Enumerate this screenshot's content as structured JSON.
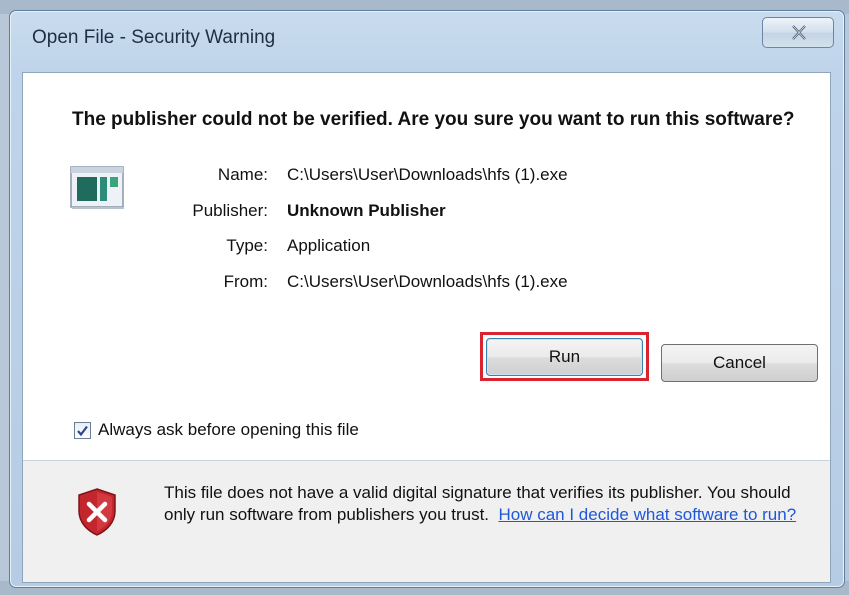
{
  "window": {
    "title": "Open File - Security Warning"
  },
  "message": {
    "headline": "The publisher could not be verified.  Are you sure you want to run this software?"
  },
  "details": [
    {
      "label": "Name:",
      "value": "C:\\Users\\User\\Downloads\\hfs (1).exe",
      "bold": false
    },
    {
      "label": "Publisher:",
      "value": "Unknown Publisher",
      "bold": true
    },
    {
      "label": "Type:",
      "value": "Application",
      "bold": false
    },
    {
      "label": "From:",
      "value": "C:\\Users\\User\\Downloads\\hfs (1).exe",
      "bold": false
    }
  ],
  "buttons": {
    "run": "Run",
    "cancel": "Cancel"
  },
  "checkbox": {
    "label": "Always ask before opening this file",
    "checked": true
  },
  "footer": {
    "text": "This file does not have a valid digital signature that verifies its publisher. You should only run software from publishers you trust.",
    "link": "How can I decide what software to run?"
  },
  "colors": {
    "highlight": "#d9232f",
    "link": "#1f58d6",
    "shield": "#c4262e"
  },
  "icons": {
    "app": "application-icon",
    "shield": "shield-warning-icon",
    "close": "close-icon",
    "check": "checkmark-icon"
  }
}
